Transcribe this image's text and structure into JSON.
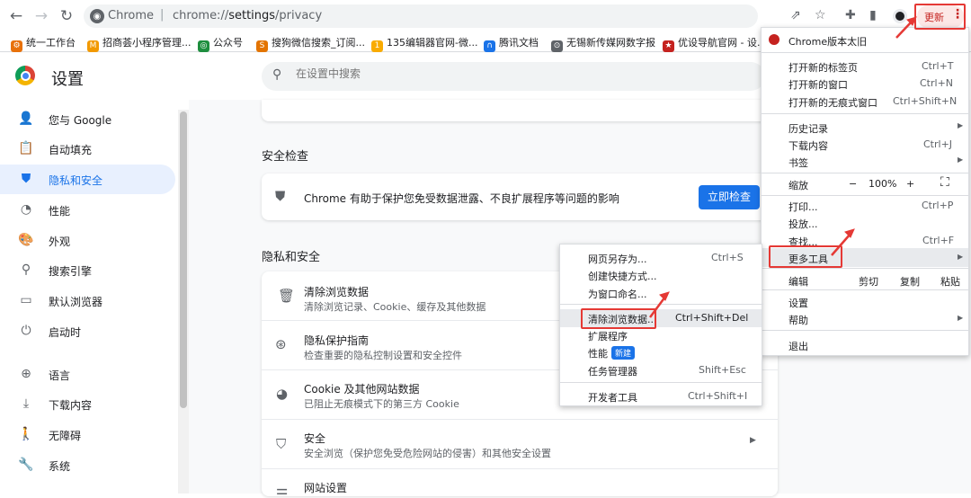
{
  "toolbar": {
    "site_label": "Chrome",
    "separator": "|",
    "url_prefix": "chrome://",
    "url_bold": "settings",
    "url_suffix": "/privacy",
    "update_label": "更新",
    "menu_dots": "⋮"
  },
  "bookmarks": [
    {
      "label": "统一工作台",
      "color": "#e8710a",
      "glyph": "⚙"
    },
    {
      "label": "招商荟小程序管理...",
      "color": "#f29900",
      "glyph": "M"
    },
    {
      "label": "公众号",
      "color": "#1e8e3e",
      "glyph": "◎"
    },
    {
      "label": "搜狗微信搜索_订阅...",
      "color": "#e37400",
      "glyph": "S"
    },
    {
      "label": "135编辑器官网-微...",
      "color": "#f9ab00",
      "glyph": "1"
    },
    {
      "label": "腾讯文档",
      "color": "#1a73e8",
      "glyph": "∩"
    },
    {
      "label": "无锡新传媒网数字报",
      "color": "#5f6368",
      "glyph": "⊙"
    },
    {
      "label": "优设导航官网 - 设...",
      "color": "#c5221f",
      "glyph": "★"
    }
  ],
  "settings": {
    "title": "设置",
    "search_placeholder": "在设置中搜索"
  },
  "sidebar": {
    "items": [
      {
        "label": "您与 Google",
        "icon": "person-icon"
      },
      {
        "label": "自动填充",
        "icon": "clipboard-icon"
      },
      {
        "label": "隐私和安全",
        "icon": "shield-icon"
      },
      {
        "label": "性能",
        "icon": "speedometer-icon"
      },
      {
        "label": "外观",
        "icon": "palette-icon"
      },
      {
        "label": "搜索引擎",
        "icon": "search-icon"
      },
      {
        "label": "默认浏览器",
        "icon": "browser-icon"
      },
      {
        "label": "启动时",
        "icon": "power-icon"
      },
      {
        "label": "语言",
        "icon": "globe-icon"
      },
      {
        "label": "下载内容",
        "icon": "download-icon"
      },
      {
        "label": "无障碍",
        "icon": "accessibility-icon"
      },
      {
        "label": "系统",
        "icon": "wrench-icon"
      }
    ]
  },
  "safety_check": {
    "heading": "安全检查",
    "text": "Chrome 有助于保护您免受数据泄露、不良扩展程序等问题的影响",
    "button": "立即检查"
  },
  "privacy": {
    "heading": "隐私和安全",
    "rows": [
      {
        "title": "清除浏览数据",
        "sub": "清除浏览记录、Cookie、缓存及其他数据",
        "icon": "trash-icon"
      },
      {
        "title": "隐私保护指南",
        "sub": "检查重要的隐私控制设置和安全控件",
        "icon": "compass-icon"
      },
      {
        "title": "Cookie 及其他网站数据",
        "sub": "已阻止无痕模式下的第三方 Cookie",
        "icon": "cookie-icon"
      },
      {
        "title": "安全",
        "sub": "安全浏览（保护您免受危险网站的侵害）和其他安全设置",
        "icon": "shield-outline-icon"
      },
      {
        "title": "网站设置",
        "sub": "",
        "icon": "sliders-icon"
      }
    ]
  },
  "chrome_menu": {
    "banner": "Chrome版本太旧",
    "new_tab": "打开新的标签页",
    "new_tab_key": "Ctrl+T",
    "new_window": "打开新的窗口",
    "new_window_key": "Ctrl+N",
    "incognito": "打开新的无痕式窗口",
    "incognito_key": "Ctrl+Shift+N",
    "history": "历史记录",
    "downloads": "下载内容",
    "downloads_key": "Ctrl+J",
    "bookmarks": "书签",
    "zoom": "缩放",
    "zoom_minus": "−",
    "zoom_value": "100%",
    "zoom_plus": "+",
    "print": "打印...",
    "print_key": "Ctrl+P",
    "cast": "投放...",
    "find": "查找...",
    "find_key": "Ctrl+F",
    "more_tools": "更多工具",
    "edit": "编辑",
    "cut": "剪切",
    "copy": "复制",
    "paste": "粘贴",
    "settings": "设置",
    "help": "帮助",
    "exit": "退出"
  },
  "more_tools_menu": {
    "save_as": "网页另存为...",
    "save_as_key": "Ctrl+S",
    "create_shortcut": "创建快捷方式...",
    "name_window": "为窗口命名...",
    "clear_data": "清除浏览数据...",
    "clear_data_key": "Ctrl+Shift+Del",
    "extensions": "扩展程序",
    "performance": "性能",
    "new_badge": "新建",
    "task_manager": "任务管理器",
    "task_manager_key": "Shift+Esc",
    "devtools": "开发者工具",
    "devtools_key": "Ctrl+Shift+I"
  }
}
